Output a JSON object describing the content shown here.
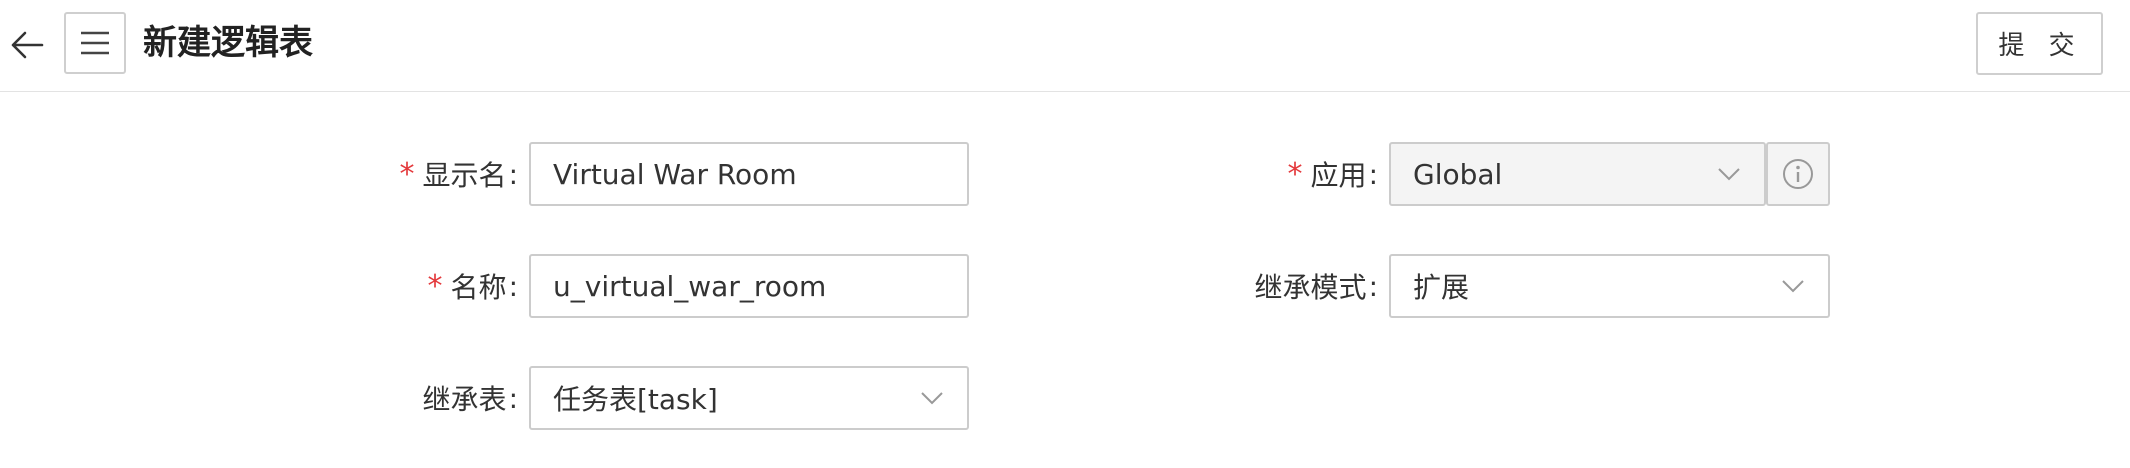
{
  "header": {
    "title": "新建逻辑表",
    "submit_label": "提 交",
    "back_icon": "arrow-left-icon",
    "menu_icon": "hamburger-menu-icon"
  },
  "form": {
    "required_mark": "*",
    "colon": ":",
    "display_name": {
      "label": "显示名",
      "value": "Virtual War Room",
      "required": true
    },
    "name": {
      "label": "名称",
      "value": "u_virtual_war_room",
      "required": true
    },
    "inherit_table": {
      "label": "继承表",
      "value": "任务表[task]",
      "required": false
    },
    "application": {
      "label": "应用",
      "value": "Global",
      "required": true,
      "info_icon": "info-circle-icon"
    },
    "inherit_mode": {
      "label": "继承模式",
      "value": "扩展",
      "required": false
    }
  },
  "colors": {
    "required": "#e4393c",
    "border": "#cccccc",
    "disabled_bg": "#f4f4f4"
  }
}
